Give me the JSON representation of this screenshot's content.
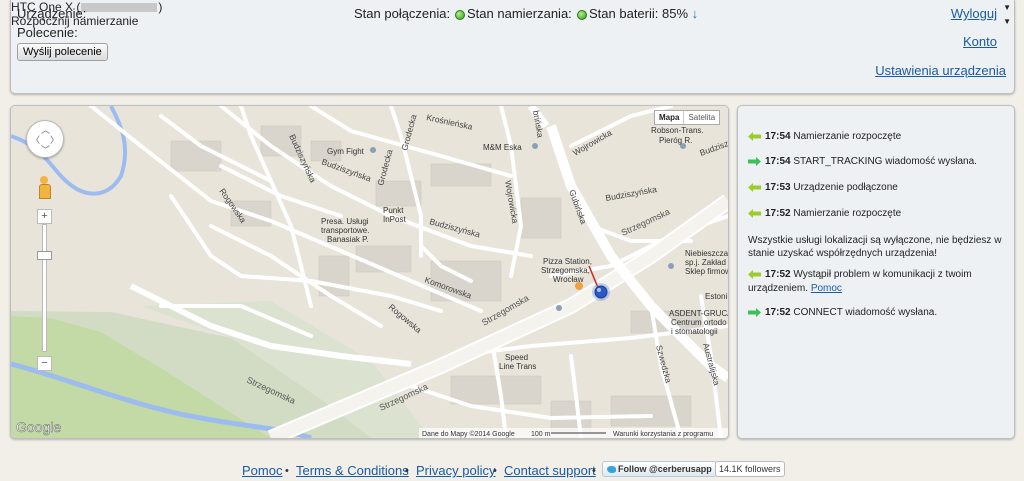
{
  "top": {
    "device_label": "Urządzenie:",
    "device_value": "HTC One X (",
    "device_value_end": ")",
    "command_label": "Polecenie:",
    "command_value": "Rozpocznij namierzanie",
    "send_button": "Wyślij polecenie",
    "status": {
      "connection": "Stan połączenia:",
      "tracking": "Stan namierzania:",
      "battery": "Stan baterii: 85%",
      "battery_arrow": "↓"
    },
    "links": {
      "logout": "Wyloguj",
      "account": "Konto",
      "device_settings": "Ustawienia urządzenia"
    }
  },
  "map": {
    "type_buttons": [
      "Mapa",
      "Satelita"
    ],
    "attribution": "Dane do Mapy ©2014 Google",
    "scale": "100 m",
    "terms": "Warunki korzystania z programu",
    "google": "Google",
    "places": {
      "gym": "Gym Fight",
      "mm": "M&M Eska",
      "robson": "Robson-Trans.",
      "robson2": "Pieróg R.",
      "presa1": "Presa. Usługi",
      "presa2": "transportowe.",
      "presa3": "Banasiak P.",
      "punkt1": "Punkt",
      "punkt2": "InPost",
      "pizza1": "Pizza Station,",
      "pizza2": "Strzegomska,",
      "pizza3": "Wrocław",
      "niebieszczanski1": "Niebieszczański",
      "niebieszczanski2": "sp.j. Zakład",
      "niebieszczanski3": "Sklep firmowy",
      "estoni": "Estoni",
      "asdent1": "ASDENT-GRUCA",
      "asdent2": "Centrum ortodo",
      "asdent3": "i stomatologii",
      "speed1": "Speed",
      "speed2": "Line Trans"
    },
    "streets": {
      "krosnienska": "Krośnieńska",
      "budziszynska1": "Budziszyńska",
      "budziszynska2": "Budziszyńska",
      "budziszynska3": "Budziszyńska",
      "budziszynska4": "Budziszyńska",
      "budziszynska5": "Budziszyńska",
      "grodecka1": "Grodecka",
      "grodecka2": "Grodecka",
      "wojrowicka": "Wojrowicka",
      "wojrowicka2": "Wojrowicka",
      "gubinska": "Gubińska",
      "brinska": "brińska",
      "rogowska1": "Rogowska",
      "rogowska2": "Rogowska",
      "komorowska": "Komorowska",
      "strzegomska1": "Strzegomska",
      "strzegomska2": "Strzegomska",
      "strzegomska3": "Strzegomska",
      "strzegomska4": "Strzegomska",
      "szwedzka": "Szwedzka",
      "australijska": "Australijska"
    }
  },
  "log": [
    {
      "time": "17:54",
      "text": "Namierzanie rozpoczęte",
      "kind": "in"
    },
    {
      "time": "17:54",
      "text": "START_TRACKING wiadomość wysłana.",
      "kind": "out"
    },
    {
      "time": "17:53",
      "text": "Urządzenie podłączone",
      "kind": "in"
    },
    {
      "time": "17:52",
      "text": "Namierzanie rozpoczęte",
      "kind": "in"
    }
  ],
  "log_notice": {
    "line1": "Wszystkie usługi lokalizacji są wyłączone, nie będziesz w",
    "line2": "stanie uzyskać współrzędnych urządzenia!"
  },
  "log_problem": {
    "time": "17:52",
    "text": "Wystąpił problem w komunikacji z twoim",
    "text2": "urządzeniem.",
    "help": "Pomoc"
  },
  "log_last": {
    "time": "17:52",
    "text": "CONNECT wiadomość wysłana."
  },
  "footer": {
    "help": "Pomoc",
    "terms": "Terms & Conditions",
    "privacy": "Privacy policy",
    "contact": "Contact support",
    "follow": "Follow @cerberusapp",
    "followers": "14.1K followers",
    "bullet": "•"
  },
  "colors": {
    "in_arrow": "#9ccc2c",
    "out_arrow": "#3fbf5a",
    "link": "#1a5aa6",
    "status_dot": "#2e9a1a"
  }
}
